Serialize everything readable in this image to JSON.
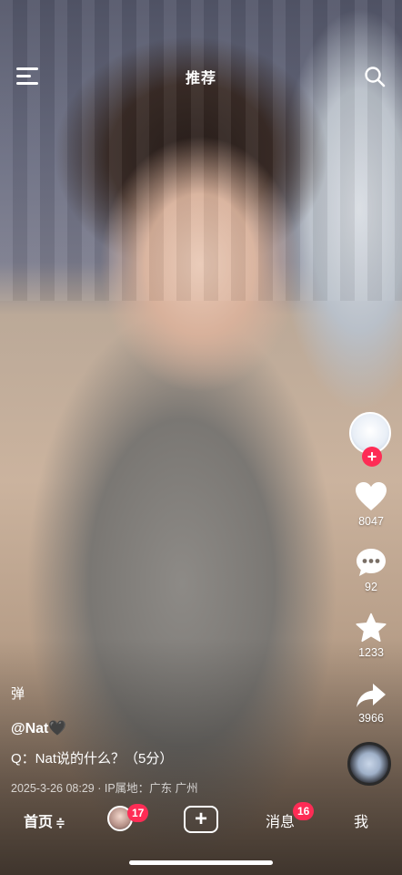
{
  "header": {
    "title": "推荐"
  },
  "rail": {
    "likes": "8047",
    "comments": "92",
    "favorites": "1233",
    "shares": "3966"
  },
  "post": {
    "extra_char": "弹",
    "author": "@Nat🖤",
    "description": "Q：Nat说的什么？（5分）",
    "meta": "2025-3-26 08:29 · IP属地：广东 广州"
  },
  "nav": {
    "home": "首页",
    "home_suffix": "≑",
    "friends_badge": "17",
    "messages": "消息",
    "messages_badge": "16",
    "me": "我"
  },
  "colors": {
    "accent": "#fe2c55",
    "text": "#ffffff"
  },
  "icons": [
    "menu-icon",
    "search-icon",
    "plus-icon",
    "heart-icon",
    "comment-icon",
    "star-icon",
    "share-icon",
    "music-disc-icon"
  ]
}
